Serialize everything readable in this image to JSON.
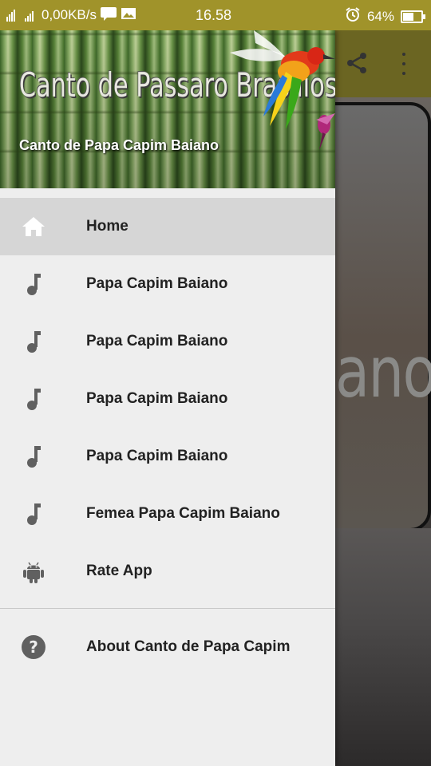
{
  "status_bar": {
    "network_speed": "0,00KB/s",
    "time": "16.58",
    "battery": "64%",
    "battery_level": 0.64
  },
  "drawer": {
    "header_logo_text": "Canto de Passaro Brasilios",
    "header_subtitle": "Canto de Papa Capim Baiano",
    "items": [
      {
        "label": "Home",
        "icon": "home-icon",
        "active": true
      },
      {
        "label": "Papa Capim Baiano",
        "icon": "music-note-icon"
      },
      {
        "label": "Papa Capim Baiano",
        "icon": "music-note-icon"
      },
      {
        "label": "Papa Capim Baiano",
        "icon": "music-note-icon"
      },
      {
        "label": "Papa Capim Baiano",
        "icon": "music-note-icon"
      },
      {
        "label": "Femea Papa Capim Baiano",
        "icon": "music-note-icon"
      },
      {
        "label": "Rate App",
        "icon": "android-icon"
      }
    ],
    "footer_item": {
      "label": "About Canto de Papa Capim",
      "icon": "help-icon"
    }
  },
  "background": {
    "partial_text": "ano"
  },
  "colors": {
    "status_bar": "#a0932a",
    "app_bar": "#6b6522",
    "drawer_bg": "#eeeeee",
    "active_item": "#d6d6d6",
    "icon_gray": "#606060"
  }
}
